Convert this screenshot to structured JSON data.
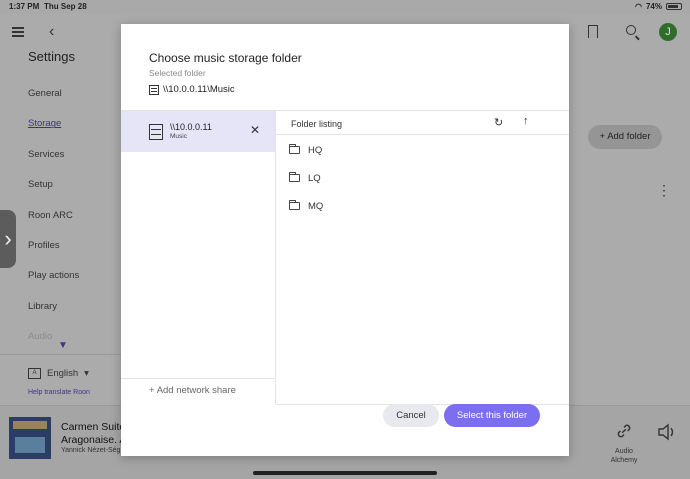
{
  "status_bar": {
    "time": "1:37 PM",
    "date": "Thu Sep 28",
    "battery": "74%"
  },
  "colors": {
    "accent": "#7b6ef0",
    "nav_active": "#3c348c",
    "selected_row": "#e6e5f8",
    "avatar": "#2f6e2a"
  },
  "top_bar": {
    "avatar_initial": "J"
  },
  "settings": {
    "title": "Settings",
    "nav": [
      "General",
      "Storage",
      "Services",
      "Setup",
      "Roon ARC",
      "Profiles",
      "Play actions",
      "Library",
      "Audio"
    ],
    "active_item": "Storage",
    "language": "English",
    "help_link": "Help translate Roon"
  },
  "storage_page": {
    "add_folder_label": "Add folder"
  },
  "now_playing": {
    "title_line1": "Carmen Suite",
    "title_line2": "Aragonaise. A",
    "artist": "Yannick Nézet-Ség",
    "zone_label": "Audio Alchemy"
  },
  "modal": {
    "title": "Choose music storage folder",
    "subtitle": "Selected folder",
    "selected_path": "\\\\10.0.0.11\\Music",
    "share": {
      "name": "\\\\10.0.0.11",
      "type": "Music"
    },
    "add_share_label": "Add network share",
    "listing_title": "Folder listing",
    "folders": [
      "HQ",
      "LQ",
      "MQ"
    ],
    "cancel_label": "Cancel",
    "select_label": "Select this folder"
  }
}
